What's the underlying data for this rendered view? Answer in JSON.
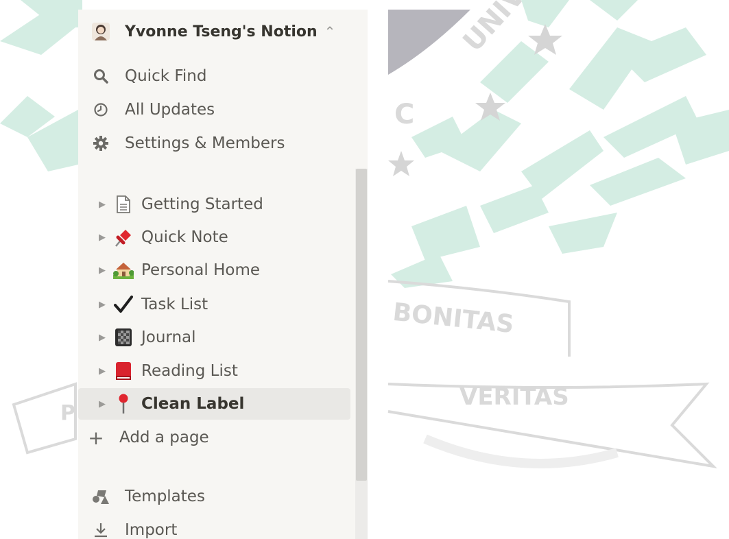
{
  "background": {
    "seal_text_top": "UNIV",
    "seal_text_c": "C",
    "ribbon_left": "P",
    "ribbon_mid": "BONITAS",
    "ribbon_right": "VERITAS"
  },
  "sidebar": {
    "workspace_name": "Yvonne Tseng's Notion",
    "workspace_switch_icon": "chevron-up-down-icon",
    "top_items": [
      {
        "label": "Quick Find",
        "icon": "search-icon"
      },
      {
        "label": "All Updates",
        "icon": "clock-icon"
      },
      {
        "label": "Settings & Members",
        "icon": "gear-icon"
      }
    ],
    "pages": [
      {
        "label": "Getting Started",
        "icon": "page-document-icon"
      },
      {
        "label": "Quick Note",
        "icon": "pushpin-icon"
      },
      {
        "label": "Personal Home",
        "icon": "house-icon"
      },
      {
        "label": "Task List",
        "icon": "checkmark-icon"
      },
      {
        "label": "Journal",
        "icon": "notebook-icon"
      },
      {
        "label": "Reading List",
        "icon": "red-book-icon"
      },
      {
        "label": "Clean Label",
        "icon": "round-pushpin-icon",
        "selected": true
      }
    ],
    "add_page_label": "Add a page",
    "bottom_items": [
      {
        "label": "Templates",
        "icon": "templates-icon"
      },
      {
        "label": "Import",
        "icon": "import-icon"
      }
    ]
  },
  "colors": {
    "sidebar_bg": "#f7f6f3",
    "text": "#37352f",
    "selected_bg": "#e9e8e5",
    "seal_green": "#d3ece2"
  }
}
